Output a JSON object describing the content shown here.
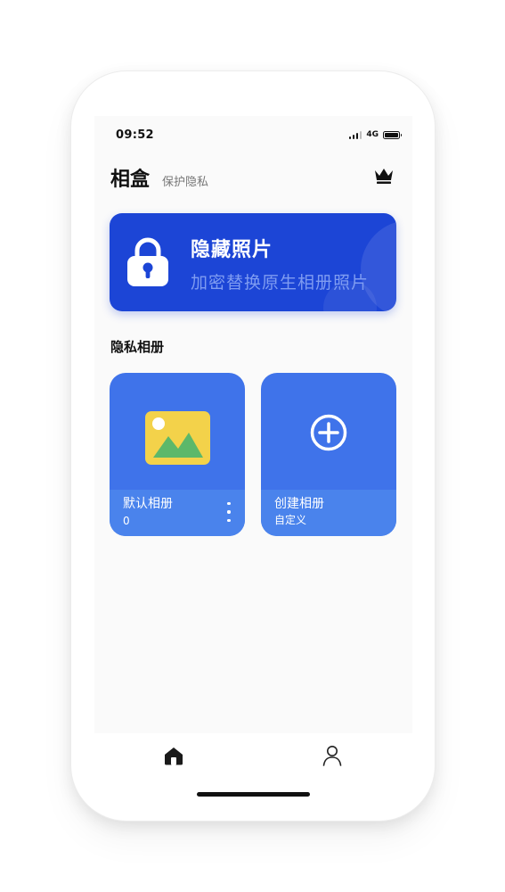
{
  "status_bar": {
    "time": "09:52",
    "network": "4G",
    "icons": [
      "signal-icon",
      "battery-icon"
    ]
  },
  "header": {
    "title": "相盒",
    "subtitle": "保护隐私",
    "vip_icon": "crown-icon"
  },
  "hero": {
    "title": "隐藏照片",
    "subtitle": "加密替换原生相册照片",
    "icon": "lock-icon",
    "color": "#1c45d6"
  },
  "section": {
    "title": "隐私相册"
  },
  "albums": [
    {
      "name": "默认相册",
      "meta": "0",
      "icon": "image-icon",
      "menu_icon": "more-vertical-icon"
    },
    {
      "name": "创建相册",
      "meta": "自定义",
      "icon": "plus-circle-icon"
    }
  ],
  "tab_bar": {
    "items": [
      {
        "icon": "home-icon",
        "active": true
      },
      {
        "icon": "user-icon",
        "active": false
      }
    ]
  },
  "colors": {
    "accent": "#1c45d6",
    "card": "#3f73ea",
    "card_footer": "#4a83ec",
    "background": "#fafafa"
  }
}
